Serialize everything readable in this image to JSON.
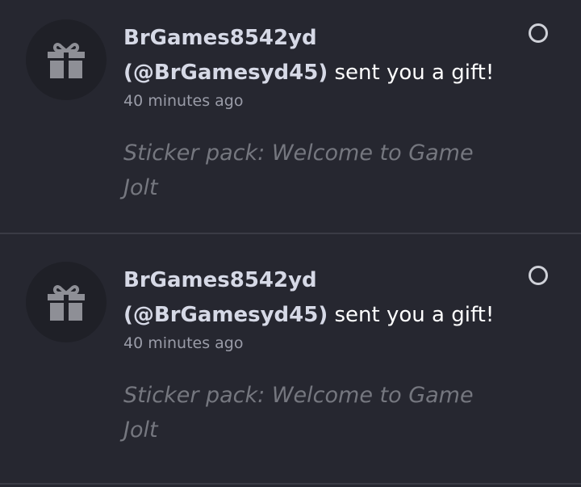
{
  "notifications": [
    {
      "icon": "gift-icon",
      "username": "BrGames8542yd",
      "handle": "(@BrGamesyd45)",
      "action": " sent you a gift!",
      "time": "40 minutes ago",
      "description": "Sticker pack: Welcome to Game Jolt"
    },
    {
      "icon": "gift-icon",
      "username": "BrGames8542yd",
      "handle": "(@BrGamesyd45)",
      "action": " sent you a gift!",
      "time": "40 minutes ago",
      "description": "Sticker pack: Welcome to Game Jolt"
    }
  ],
  "colors": {
    "background": "#262730",
    "avatar_background": "#1f2027",
    "icon": "#8e8f96",
    "username": "#d6d9e6",
    "body_text": "#ffffff",
    "muted_text": "#75777f"
  }
}
